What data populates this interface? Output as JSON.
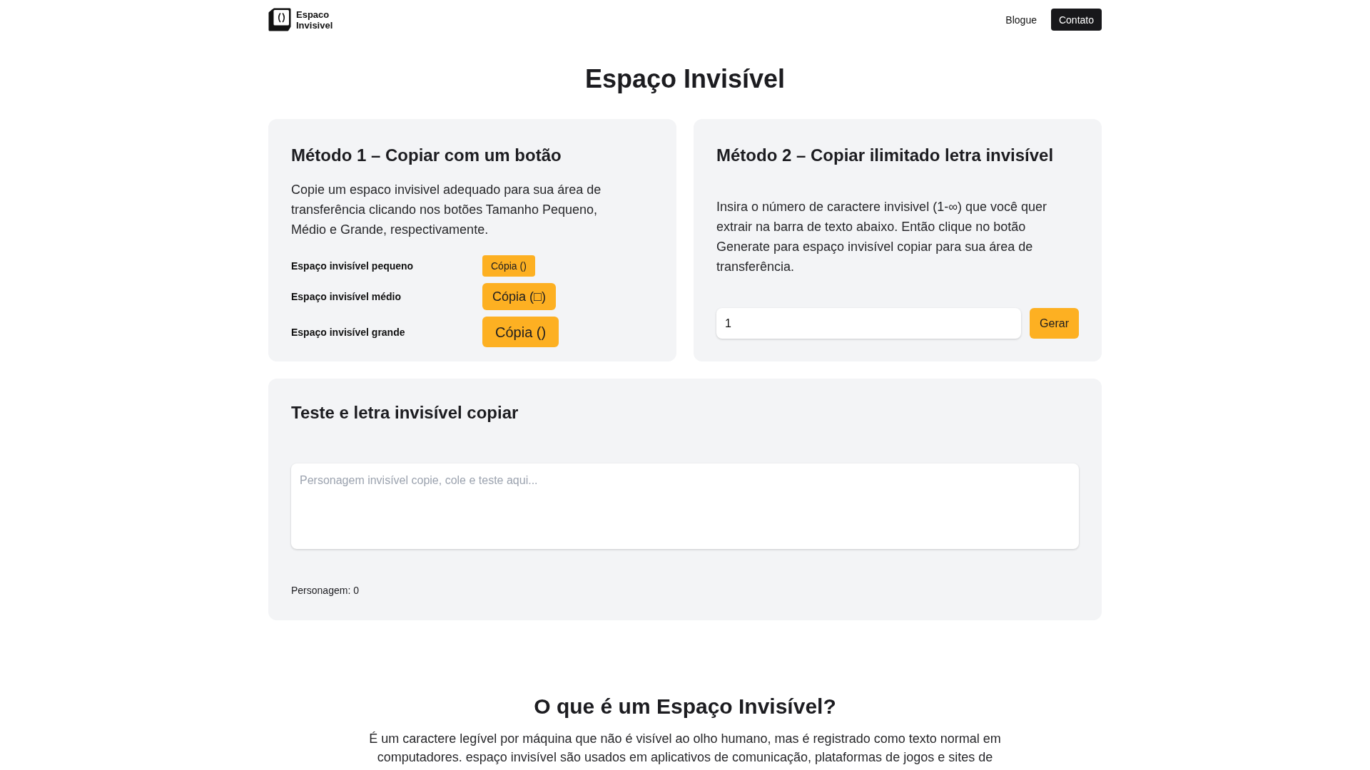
{
  "header": {
    "brand": "Espaco Invisivel",
    "nav": [
      {
        "label": "Blogue",
        "kind": "link"
      },
      {
        "label": "Contato",
        "kind": "button"
      }
    ]
  },
  "title": "Espaço Invisível",
  "method_1": {
    "heading": "Método 1 – Copiar com um botão",
    "description": "Copie um espaco invisivel adequado para sua área de transferência clicando nos botões Tamanho Pequeno, Médio e Grande, respectivamente.",
    "rows": [
      {
        "label": "Espaço invisível pequeno",
        "button": "Cópia ()",
        "kind": "small"
      },
      {
        "label": "Espaço invisível médio",
        "button": "Cópia (□)",
        "kind": "medium"
      },
      {
        "label": "Espaço invisível grande",
        "button": "Cópia ()",
        "kind": "large"
      }
    ]
  },
  "method_2": {
    "heading": "Método 2 – Copiar ilimitado letra invisível",
    "description": "Insira o número de caractere invisivel (1-∞) que você quer extrair na barra de texto abaixo. Então clique no botão Generate para espaço invisível copiar para sua área de transferência.",
    "input": {
      "value": "1"
    },
    "button": "Gerar"
  },
  "test": {
    "heading": "Teste e letra invisível copiar",
    "textarea": {
      "placeholder": "Personagem invisível copie, cole e teste aqui..."
    },
    "counter": "Personagem: 0"
  },
  "about": {
    "heading": "O que é um Espaço Invisível?",
    "text": "É um caractere legível por máquina que não é visível ao olho humano, mas é registrado como texto normal em computadores. espaço invisível são usados em aplicativos de comunicação, plataformas de jogos e sites de"
  }
}
